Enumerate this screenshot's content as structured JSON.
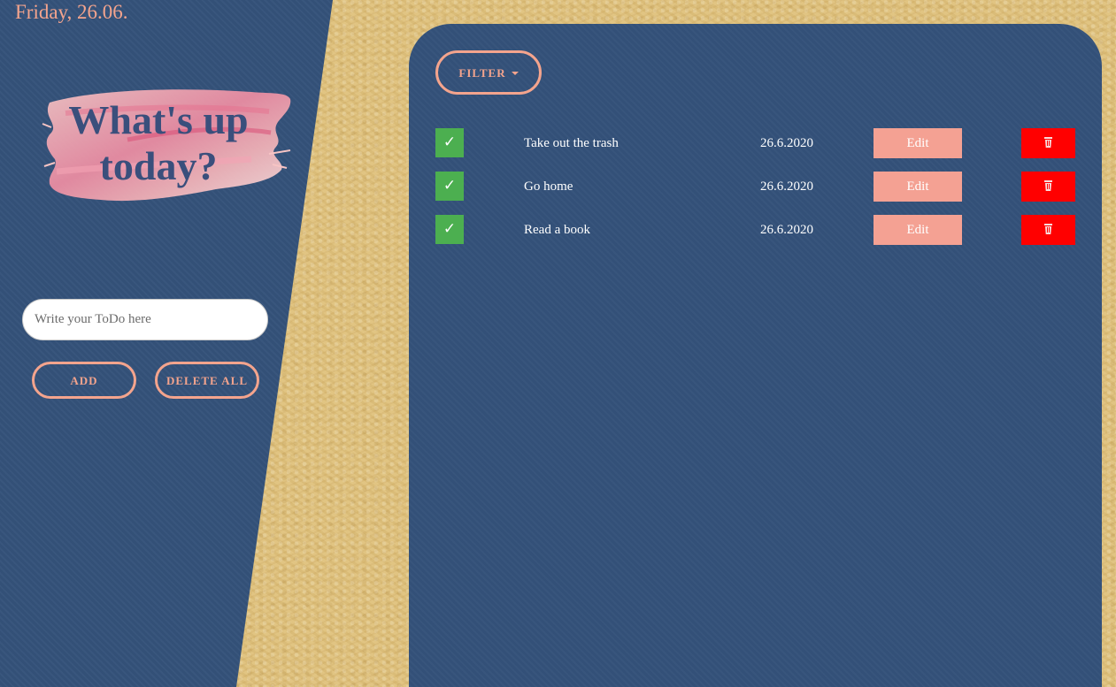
{
  "date": "Friday, 26.06.",
  "headline": "What's up\ntoday?",
  "input": {
    "placeholder": "Write your ToDo here",
    "value": ""
  },
  "buttons": {
    "add": "ADD",
    "delete_all": "DELETE ALL",
    "filter": "FILTER"
  },
  "todos": [
    {
      "text": "Take out the trash",
      "date": "26.6.2020",
      "edit": "Edit",
      "check": "✓"
    },
    {
      "text": "Go home",
      "date": "26.6.2020",
      "edit": "Edit",
      "check": "✓"
    },
    {
      "text": "Read a book",
      "date": "26.6.2020",
      "edit": "Edit",
      "check": "✓"
    }
  ],
  "colors": {
    "panel": "#34527a",
    "accent": "#f4a48d",
    "check": "#4caf50",
    "delete": "#ff0000",
    "edit": "#f4a193",
    "background": "#dcbe7a"
  },
  "icons": {
    "filter_caret": "chevron-down-icon",
    "check": "check-icon",
    "delete": "trash-icon"
  }
}
